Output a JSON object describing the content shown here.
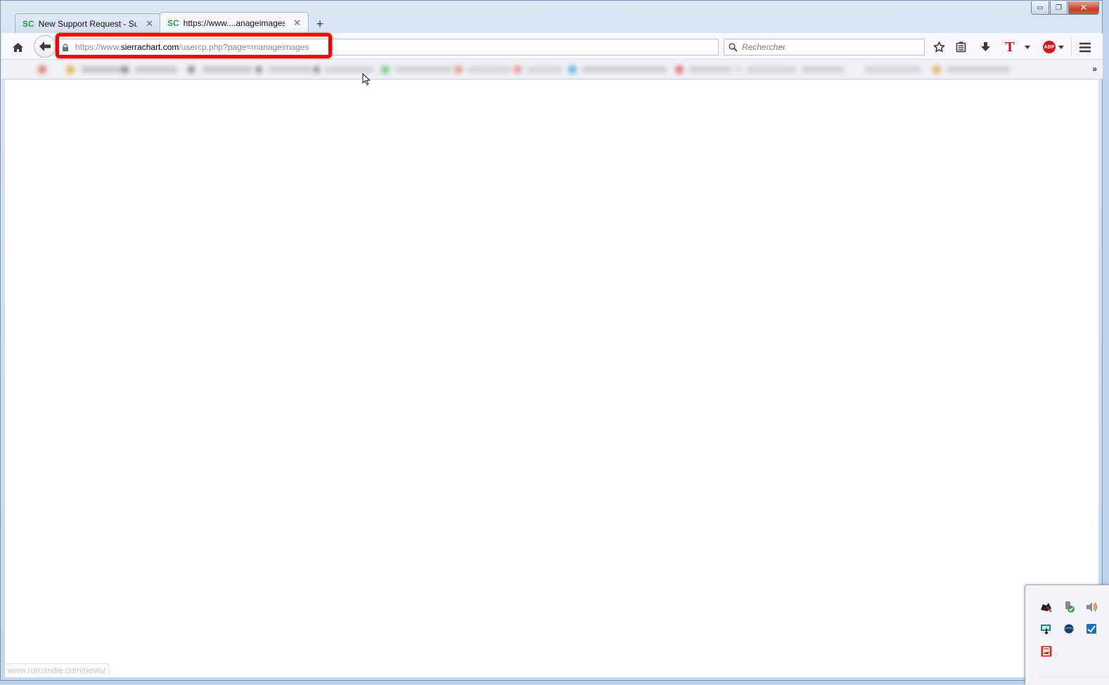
{
  "window": {
    "controls": {
      "minimize": "▭",
      "maximize": "❐",
      "close": "✕"
    }
  },
  "tabs": [
    {
      "favicon": "SC",
      "title": "New Support Request - Su...",
      "close": "✕",
      "active": false
    },
    {
      "favicon": "SC",
      "title": "https://www....anageimages",
      "close": "✕",
      "active": true
    }
  ],
  "new_tab": "+",
  "urlbar": {
    "prefix": "https://www.",
    "domain": "sierrachart.com",
    "path": "/usercp.php?page=manageimages"
  },
  "search": {
    "placeholder": "Rechercher"
  },
  "bookmarks": {
    "overflow": "»"
  },
  "toolbar_icons": [
    "home-icon",
    "back-arrow-icon",
    "lock-icon",
    "reload-icon",
    "search-icon",
    "star-icon",
    "reader-list-icon",
    "download-icon",
    "t-extension-icon",
    "adblock-plus-icon",
    "hamburger-menu-icon"
  ],
  "extension_labels": {
    "t_button": "T",
    "abp": "ABP"
  },
  "status": {
    "url": "www.romandie.com/news/"
  },
  "colors": {
    "highlight": "#ff0000",
    "favicon": "#22a23c",
    "window_frame": "#c6d7ec"
  }
}
